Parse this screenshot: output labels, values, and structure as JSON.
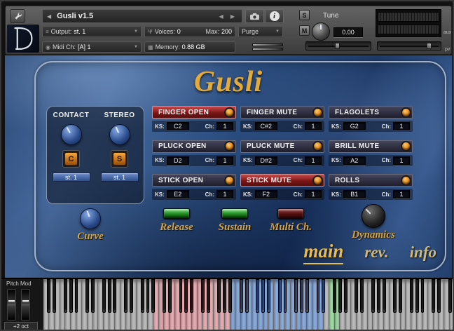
{
  "colors": {
    "gold_accent": "#e0aa3c",
    "active_red": "#a02828",
    "orange_button": "#d88a28",
    "led_green": "#35b535",
    "led_off_red": "#6a1515",
    "panel_blue": "#2d5082"
  },
  "header": {
    "title": "Gusli v1.5",
    "icons": {
      "back_arrow": "◀",
      "prev_arrow": "◀",
      "next_arrow": "▶",
      "dropdown_arrow": "▼",
      "output": "≡",
      "voices": "Ψ",
      "midi": "◉",
      "memory": "▦"
    },
    "solo_label": "S",
    "mute_label": "M",
    "tune": {
      "label": "Tune",
      "value": "0.00"
    },
    "output": {
      "label": "Output:",
      "value": "st. 1"
    },
    "voices": {
      "label": "Voices:",
      "value": "0",
      "max_label": "Max:",
      "max_value": "200"
    },
    "purge_label": "Purge",
    "midi": {
      "label": "Midi Ch:",
      "value": "[A] 1"
    },
    "memory": {
      "label": "Memory:",
      "value": "0.88 GB"
    },
    "aux_label": "aux",
    "pv_label": "pv",
    "pan_percent": 45,
    "volume_percent": 78
  },
  "main": {
    "title": "Gusli",
    "labels": {
      "ks": "KS:",
      "ch": "Ch:"
    },
    "left_panel": {
      "contact_label": "CONTACT",
      "stereo_label": "STEREO",
      "contact_button": "C",
      "stereo_button": "S",
      "contact_output": "st. 1",
      "stereo_output": "st. 1",
      "curve_label": "Curve"
    },
    "articulations": [
      {
        "name": "FINGER OPEN",
        "ks": "C2",
        "ch": "1",
        "active": true
      },
      {
        "name": "FINGER MUTE",
        "ks": "C#2",
        "ch": "1",
        "active": false
      },
      {
        "name": "FLAGOLETS",
        "ks": "G2",
        "ch": "1",
        "active": false
      },
      {
        "name": "PLUCK OPEN",
        "ks": "D2",
        "ch": "1",
        "active": false
      },
      {
        "name": "PLUCK MUTE",
        "ks": "D#2",
        "ch": "1",
        "active": false
      },
      {
        "name": "BRILL MUTE",
        "ks": "A2",
        "ch": "1",
        "active": false
      },
      {
        "name": "STICK OPEN",
        "ks": "E2",
        "ch": "1",
        "active": false
      },
      {
        "name": "STICK MUTE",
        "ks": "F2",
        "ch": "1",
        "active": true
      },
      {
        "name": "ROLLS",
        "ks": "B1",
        "ch": "1",
        "active": false
      }
    ],
    "switches": [
      {
        "label": "Release",
        "color": "green",
        "on": true
      },
      {
        "label": "Sustain",
        "color": "green",
        "on": true
      },
      {
        "label": "Multi Ch.",
        "color": "red",
        "on": false
      }
    ],
    "dynamics_label": "Dynamics",
    "tabs": [
      {
        "label": "main",
        "active": true
      },
      {
        "label": "rev.",
        "active": false
      },
      {
        "label": "info",
        "active": false
      }
    ]
  },
  "keyboard": {
    "pitch_mod_label": "Pitch Mod",
    "octave_label": "+2 oct",
    "white_key_count": 75,
    "default_white": "#c3c3c3",
    "default_black": "#161616",
    "zones": [
      {
        "start": 20,
        "end": 34,
        "white": "#efb4ba",
        "black": "#2a1216"
      },
      {
        "start": 34,
        "end": 51,
        "white": "#92b2e2",
        "black": "#31589e"
      },
      {
        "start": 52,
        "end": 54,
        "white": "#a9e2ad",
        "black": "#161616"
      }
    ]
  }
}
